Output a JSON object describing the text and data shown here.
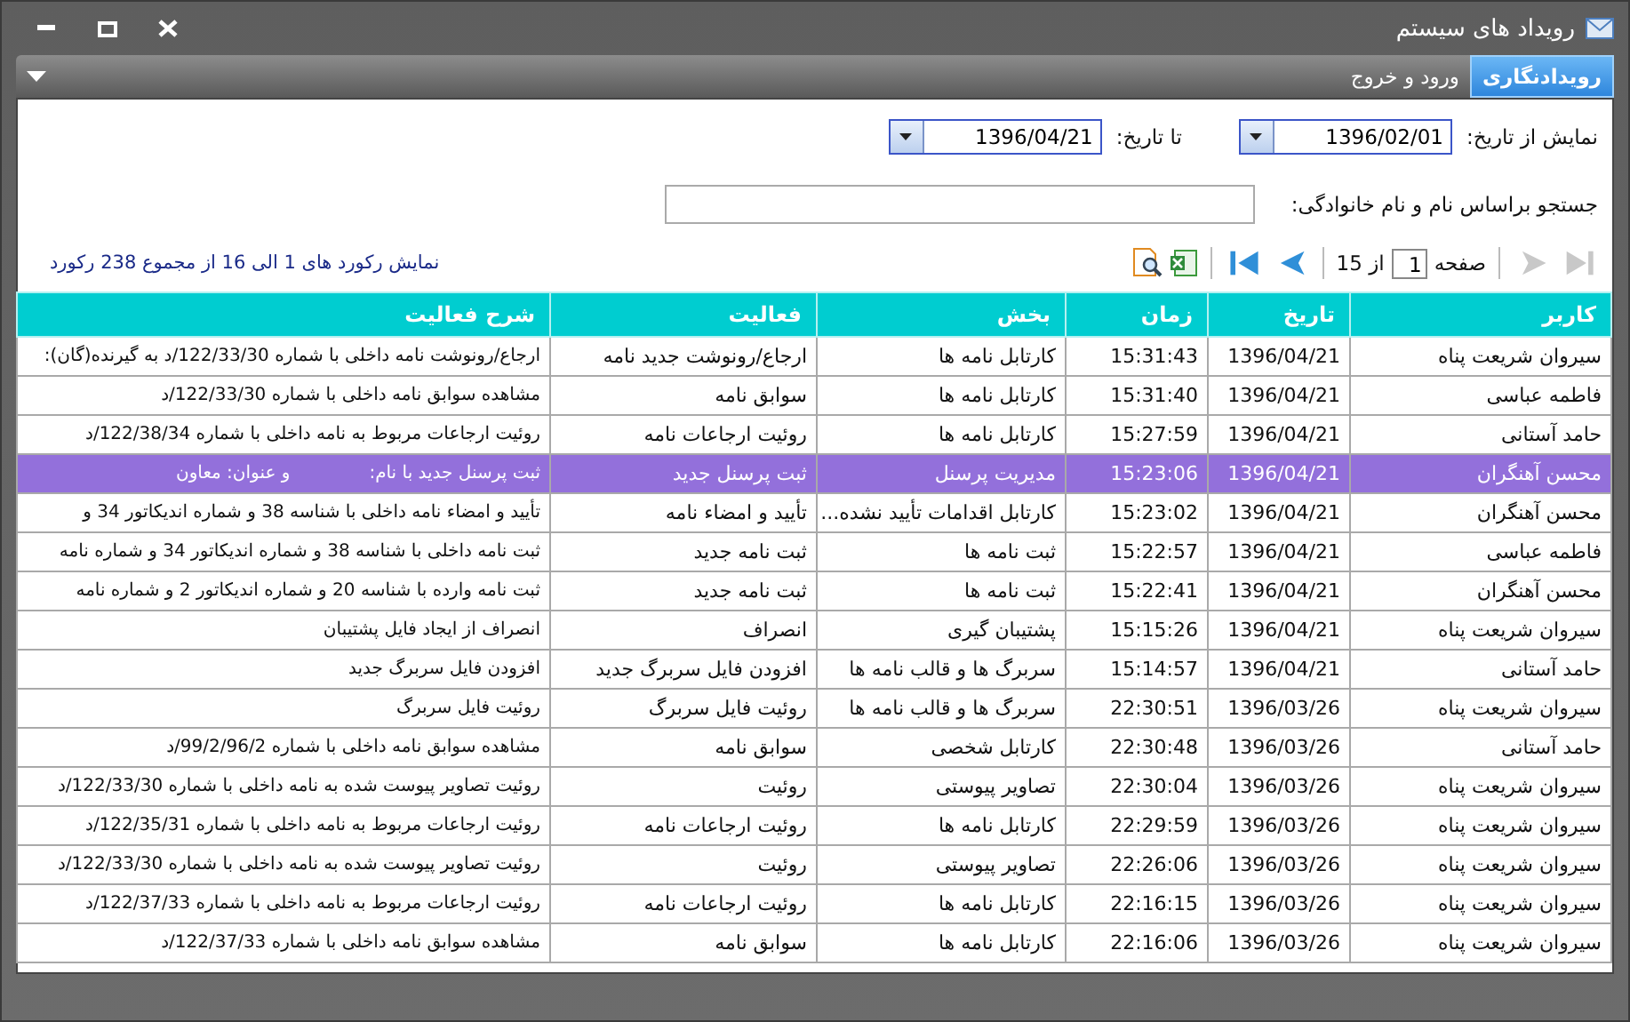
{
  "window": {
    "title": "رویداد های سیستم"
  },
  "tabs": [
    {
      "label": "رویدادنگاری",
      "selected": true
    },
    {
      "label": "ورود و خروج",
      "selected": false
    }
  ],
  "filters": {
    "from_label": "نمایش از تاریخ:",
    "from_value": "1396/02/01",
    "to_label": "تا تاریخ:",
    "to_value": "1396/04/21",
    "search_label": "جستجو براساس نام و نام خانوادگی:"
  },
  "pager": {
    "page_label": "صفحه",
    "page_value": "1",
    "of_label": "از 15",
    "summary": "نمایش رکورد های 1 الی 16 از مجموع 238 رکورد",
    "buttons": [
      {
        "kind": "last",
        "disabled": true
      },
      {
        "kind": "next",
        "disabled": true
      },
      {
        "kind": "previous",
        "disabled": false
      },
      {
        "kind": "first",
        "disabled": false
      }
    ]
  },
  "table": {
    "columns": [
      "کاربر",
      "تاریخ",
      "زمان",
      "بخش",
      "فعالیت",
      "شرح فعالیت"
    ],
    "rows": [
      {
        "selected": false,
        "cells": [
          "سیروان شریعت پناه",
          "1396/04/21",
          "15:31:43",
          "کارتابل نامه ها",
          "ارجاع/رونوشت جدید نامه",
          "ارجاع/رونوشت نامه داخلی با شماره 122/33/30/د به گیرنده(گان):"
        ]
      },
      {
        "selected": false,
        "cells": [
          "فاطمه عباسی",
          "1396/04/21",
          "15:31:40",
          "کارتابل نامه ها",
          "سوابق نامه",
          "مشاهده سوابق نامه داخلی با شماره 122/33/30/د"
        ]
      },
      {
        "selected": false,
        "cells": [
          "حامد آستانی",
          "1396/04/21",
          "15:27:59",
          "کارتابل نامه ها",
          "روئیت ارجاعات نامه",
          "روئیت ارجاعات مربوط به نامه داخلی با شماره 122/38/34/د"
        ]
      },
      {
        "selected": true,
        "cells": [
          "محسن آهنگران",
          "1396/04/21",
          "15:23:06",
          "مدیریت پرسنل",
          "ثبت پرسنل جدید",
          "ثبت پرسنل جدید با نام:              و عنوان: معاون"
        ]
      },
      {
        "selected": false,
        "cells": [
          "محسن آهنگران",
          "1396/04/21",
          "15:23:02",
          "کارتابل اقدامات تأیید نشده...",
          "تأیید و امضاء نامه",
          "تأیید و امضاء نامه داخلی با شناسه 38 و شماره اندیکاتور 34 و"
        ]
      },
      {
        "selected": false,
        "cells": [
          "فاطمه عباسی",
          "1396/04/21",
          "15:22:57",
          "ثبت نامه ها",
          "ثبت نامه جدید",
          "ثبت نامه داخلی با شناسه 38 و شماره اندیکاتور 34 و شماره نامه"
        ]
      },
      {
        "selected": false,
        "cells": [
          "محسن آهنگران",
          "1396/04/21",
          "15:22:41",
          "ثبت نامه ها",
          "ثبت نامه جدید",
          "ثبت نامه وارده با شناسه 20 و شماره اندیکاتور 2 و شماره نامه"
        ]
      },
      {
        "selected": false,
        "cells": [
          "سیروان شریعت پناه",
          "1396/04/21",
          "15:15:26",
          "پشتیبان گیری",
          "انصراف",
          "انصراف از ایجاد فایل پشتیبان"
        ]
      },
      {
        "selected": false,
        "cells": [
          "حامد آستانی",
          "1396/04/21",
          "15:14:57",
          "سربرگ ها و قالب نامه ها",
          "افزودن فایل سربرگ جدید",
          "افزودن فایل سربرگ جدید"
        ]
      },
      {
        "selected": false,
        "cells": [
          "سیروان شریعت پناه",
          "1396/03/26",
          "22:30:51",
          "سربرگ ها و قالب نامه ها",
          "روئیت فایل سربرگ",
          "روئیت فایل سربرگ"
        ]
      },
      {
        "selected": false,
        "cells": [
          "حامد آستانی",
          "1396/03/26",
          "22:30:48",
          "کارتابل شخصی",
          "سوابق نامه",
          "مشاهده سوابق نامه داخلی با شماره 99/2/96/2/د"
        ]
      },
      {
        "selected": false,
        "cells": [
          "سیروان شریعت پناه",
          "1396/03/26",
          "22:30:04",
          "تصاویر پیوستی",
          "روئیت",
          "روئیت تصاویر پیوست شده به نامه داخلی با شماره 122/33/30/د"
        ]
      },
      {
        "selected": false,
        "cells": [
          "سیروان شریعت پناه",
          "1396/03/26",
          "22:29:59",
          "کارتابل نامه ها",
          "روئیت ارجاعات نامه",
          "روئیت ارجاعات مربوط به نامه داخلی با شماره 122/35/31/د"
        ]
      },
      {
        "selected": false,
        "cells": [
          "سیروان شریعت پناه",
          "1396/03/26",
          "22:26:06",
          "تصاویر پیوستی",
          "روئیت",
          "روئیت تصاویر پیوست شده به نامه داخلی با شماره 122/33/30/د"
        ]
      },
      {
        "selected": false,
        "cells": [
          "سیروان شریعت پناه",
          "1396/03/26",
          "22:16:15",
          "کارتابل نامه ها",
          "روئیت ارجاعات نامه",
          "روئیت ارجاعات مربوط به نامه داخلی با شماره 122/37/33/د"
        ]
      },
      {
        "selected": false,
        "cells": [
          "سیروان شریعت پناه",
          "1396/03/26",
          "22:16:06",
          "کارتابل نامه ها",
          "سوابق نامه",
          "مشاهده سوابق نامه داخلی با شماره 122/37/33/د"
        ]
      }
    ]
  }
}
